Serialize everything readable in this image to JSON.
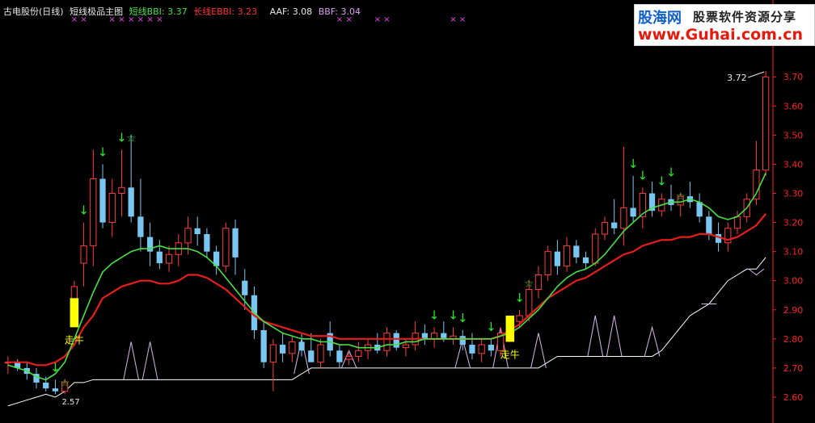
{
  "header": {
    "stock": "古电股份(日线)",
    "indicator": "短线极品主图",
    "short_label": "短线BBI:",
    "short_value": "3.37",
    "long_label": "长线EBBI:",
    "long_value": "3.23",
    "aaf_label": "AAF:",
    "aaf_value": "3.08",
    "bbf_label": "BBF:",
    "bbf_value": "3.04"
  },
  "logo": {
    "name": "股海网",
    "slogan": "股票软件资源分享",
    "url": "www.Guhai.com.cn"
  },
  "colors": {
    "up": "#ff3c3c",
    "down": "#79c7f1",
    "short_line": "#44e044",
    "long_line": "#e81c1c",
    "axis": "#ff2020",
    "signal": "#ffff00",
    "arrow": "#22ee22",
    "lower_line": "#ffffff",
    "spike": "#d9b8ee",
    "mark": "#ee44ee"
  },
  "chart_data": {
    "type": "candlestick",
    "y_axis": {
      "ticks": [
        "2.60",
        "2.70",
        "2.80",
        "2.90",
        "3.00",
        "3.10",
        "3.20",
        "3.30",
        "3.40",
        "3.50",
        "3.60",
        "3.70"
      ],
      "min": 2.55,
      "max": 3.77,
      "side": "right"
    },
    "annotations": {
      "max_label": "3.72",
      "min_label": "2.57",
      "signal_text": "走牛",
      "x_mark": "×",
      "arrow": "↓",
      "star": "☆"
    },
    "candles": [
      [
        2.72,
        2.74,
        2.68,
        2.72
      ],
      [
        2.72,
        2.73,
        2.69,
        2.7
      ],
      [
        2.7,
        2.72,
        2.66,
        2.68
      ],
      [
        2.68,
        2.7,
        2.63,
        2.65
      ],
      [
        2.65,
        2.67,
        2.62,
        2.63
      ],
      [
        2.63,
        2.66,
        2.61,
        2.62
      ],
      [
        2.62,
        2.66,
        2.61,
        2.65
      ],
      [
        2.85,
        3.0,
        2.84,
        2.98
      ],
      [
        3.06,
        3.2,
        2.98,
        3.12
      ],
      [
        3.12,
        3.45,
        3.05,
        3.35
      ],
      [
        3.35,
        3.4,
        3.18,
        3.2
      ],
      [
        3.2,
        3.35,
        3.15,
        3.3
      ],
      [
        3.3,
        3.45,
        3.22,
        3.32
      ],
      [
        3.32,
        3.5,
        3.2,
        3.22
      ],
      [
        3.22,
        3.35,
        3.1,
        3.15
      ],
      [
        3.15,
        3.2,
        3.05,
        3.1
      ],
      [
        3.1,
        3.14,
        3.04,
        3.06
      ],
      [
        3.06,
        3.12,
        3.03,
        3.09
      ],
      [
        3.09,
        3.16,
        3.05,
        3.13
      ],
      [
        3.13,
        3.22,
        3.09,
        3.18
      ],
      [
        3.18,
        3.22,
        3.12,
        3.16
      ],
      [
        3.16,
        3.18,
        3.08,
        3.1
      ],
      [
        3.1,
        3.12,
        3.02,
        3.05
      ],
      [
        3.05,
        3.2,
        3.03,
        3.18
      ],
      [
        3.18,
        3.21,
        3.02,
        3.08
      ],
      [
        3.0,
        3.04,
        2.9,
        2.95
      ],
      [
        2.95,
        2.98,
        2.8,
        2.83
      ],
      [
        2.83,
        2.86,
        2.7,
        2.72
      ],
      [
        2.72,
        2.8,
        2.62,
        2.78
      ],
      [
        2.78,
        2.82,
        2.72,
        2.75
      ],
      [
        2.75,
        2.81,
        2.72,
        2.79
      ],
      [
        2.79,
        2.82,
        2.74,
        2.76
      ],
      [
        2.76,
        2.82,
        2.73,
        2.72
      ],
      [
        2.72,
        2.8,
        2.7,
        2.78
      ],
      [
        2.82,
        2.86,
        2.74,
        2.76
      ],
      [
        2.76,
        2.78,
        2.7,
        2.72
      ],
      [
        2.73,
        2.76,
        2.71,
        2.74
      ],
      [
        2.74,
        2.79,
        2.72,
        2.76
      ],
      [
        2.76,
        2.8,
        2.73,
        2.78
      ],
      [
        2.78,
        2.82,
        2.75,
        2.76
      ],
      [
        2.76,
        2.84,
        2.74,
        2.82
      ],
      [
        2.82,
        2.83,
        2.76,
        2.77
      ],
      [
        2.77,
        2.8,
        2.74,
        2.78
      ],
      [
        2.78,
        2.86,
        2.76,
        2.82
      ],
      [
        2.82,
        2.85,
        2.78,
        2.8
      ],
      [
        2.8,
        2.84,
        2.77,
        2.82
      ],
      [
        2.82,
        2.86,
        2.79,
        2.8
      ],
      [
        2.8,
        2.84,
        2.78,
        2.81
      ],
      [
        2.81,
        2.83,
        2.76,
        2.78
      ],
      [
        2.78,
        2.82,
        2.73,
        2.75
      ],
      [
        2.75,
        2.8,
        2.72,
        2.78
      ],
      [
        2.78,
        2.8,
        2.74,
        2.76
      ],
      [
        2.76,
        2.84,
        2.74,
        2.82
      ],
      [
        2.82,
        2.88,
        2.8,
        2.86
      ],
      [
        2.86,
        2.9,
        2.84,
        2.88
      ],
      [
        2.88,
        3.0,
        2.86,
        2.97
      ],
      [
        2.97,
        3.05,
        2.94,
        3.02
      ],
      [
        3.02,
        3.12,
        3.0,
        3.1
      ],
      [
        3.1,
        3.14,
        3.02,
        3.05
      ],
      [
        3.05,
        3.15,
        3.03,
        3.12
      ],
      [
        3.12,
        3.14,
        3.06,
        3.08
      ],
      [
        3.08,
        3.1,
        3.04,
        3.06
      ],
      [
        3.06,
        3.18,
        3.05,
        3.16
      ],
      [
        3.16,
        3.22,
        3.14,
        3.2
      ],
      [
        3.2,
        3.28,
        3.16,
        3.18
      ],
      [
        3.18,
        3.46,
        3.12,
        3.25
      ],
      [
        3.25,
        3.36,
        3.2,
        3.22
      ],
      [
        3.22,
        3.32,
        3.18,
        3.3
      ],
      [
        3.3,
        3.34,
        3.22,
        3.24
      ],
      [
        3.24,
        3.3,
        3.22,
        3.28
      ],
      [
        3.28,
        3.33,
        3.24,
        3.26
      ],
      [
        3.26,
        3.3,
        3.22,
        3.29
      ],
      [
        3.29,
        3.34,
        3.25,
        3.27
      ],
      [
        3.27,
        3.3,
        3.2,
        3.22
      ],
      [
        3.22,
        3.24,
        3.14,
        3.16
      ],
      [
        3.16,
        3.2,
        3.1,
        3.13
      ],
      [
        3.13,
        3.2,
        3.1,
        3.18
      ],
      [
        3.18,
        3.24,
        3.16,
        3.22
      ],
      [
        3.22,
        3.3,
        3.2,
        3.28
      ],
      [
        3.28,
        3.48,
        3.26,
        3.38
      ],
      [
        3.38,
        3.72,
        3.36,
        3.7
      ]
    ],
    "short_bbi": [
      2.71,
      2.7,
      2.69,
      2.67,
      2.66,
      2.68,
      2.72,
      2.8,
      2.88,
      2.96,
      3.03,
      3.06,
      3.08,
      3.1,
      3.11,
      3.11,
      3.12,
      3.11,
      3.11,
      3.11,
      3.1,
      3.08,
      3.05,
      3.01,
      2.97,
      2.93,
      2.89,
      2.86,
      2.84,
      2.82,
      2.81,
      2.8,
      2.8,
      2.79,
      2.79,
      2.78,
      2.78,
      2.77,
      2.77,
      2.77,
      2.78,
      2.78,
      2.79,
      2.79,
      2.8,
      2.8,
      2.8,
      2.8,
      2.8,
      2.8,
      2.8,
      2.8,
      2.81,
      2.82,
      2.84,
      2.87,
      2.9,
      2.94,
      2.98,
      3.01,
      3.03,
      3.04,
      3.06,
      3.09,
      3.13,
      3.17,
      3.2,
      3.23,
      3.25,
      3.26,
      3.27,
      3.27,
      3.28,
      3.27,
      3.25,
      3.22,
      3.21,
      3.22,
      3.25,
      3.3,
      3.37
    ],
    "long_ebbi": [
      2.72,
      2.72,
      2.72,
      2.71,
      2.71,
      2.72,
      2.74,
      2.78,
      2.84,
      2.88,
      2.94,
      2.96,
      2.98,
      2.99,
      3.0,
      3.0,
      2.99,
      2.99,
      3.0,
      3.02,
      3.02,
      3.01,
      2.99,
      2.97,
      2.94,
      2.91,
      2.88,
      2.86,
      2.85,
      2.84,
      2.83,
      2.82,
      2.81,
      2.81,
      2.81,
      2.8,
      2.8,
      2.8,
      2.8,
      2.8,
      2.8,
      2.8,
      2.8,
      2.8,
      2.8,
      2.8,
      2.8,
      2.8,
      2.8,
      2.8,
      2.8,
      2.8,
      2.81,
      2.83,
      2.85,
      2.88,
      2.91,
      2.94,
      2.96,
      2.98,
      3.0,
      3.01,
      3.03,
      3.05,
      3.07,
      3.09,
      3.1,
      3.12,
      3.13,
      3.14,
      3.14,
      3.15,
      3.15,
      3.16,
      3.16,
      3.15,
      3.14,
      3.15,
      3.17,
      3.19,
      3.23
    ],
    "lower_line": [
      2.57,
      2.58,
      2.59,
      2.6,
      2.61,
      2.6,
      2.62,
      2.65,
      2.65,
      2.66,
      2.66,
      2.66,
      2.66,
      2.66,
      2.66,
      2.66,
      2.66,
      2.66,
      2.66,
      2.66,
      2.66,
      2.66,
      2.66,
      2.66,
      2.66,
      2.66,
      2.66,
      2.66,
      2.66,
      2.66,
      2.66,
      2.68,
      2.7,
      2.7,
      2.7,
      2.7,
      2.7,
      2.7,
      2.7,
      2.7,
      2.7,
      2.7,
      2.7,
      2.7,
      2.7,
      2.7,
      2.7,
      2.7,
      2.7,
      2.7,
      2.7,
      2.7,
      2.7,
      2.7,
      2.7,
      2.7,
      2.7,
      2.72,
      2.74,
      2.74,
      2.74,
      2.74,
      2.74,
      2.74,
      2.74,
      2.74,
      2.74,
      2.74,
      2.74,
      2.76,
      2.8,
      2.84,
      2.88,
      2.9,
      2.92,
      2.96,
      3.0,
      3.02,
      3.04,
      3.04,
      3.08
    ],
    "spikes": [
      [
        13,
        2.79
      ],
      [
        15,
        2.79
      ],
      [
        31,
        2.8
      ],
      [
        36,
        2.76
      ],
      [
        48,
        2.8
      ],
      [
        52,
        2.84
      ],
      [
        56,
        2.82
      ],
      [
        62,
        2.88
      ],
      [
        64,
        2.88
      ],
      [
        68,
        2.84
      ],
      [
        74,
        2.92
      ],
      [
        79,
        3.02
      ]
    ],
    "signals": [
      {
        "i": 7,
        "from": 2.84,
        "to": 2.94
      },
      {
        "i": 53,
        "from": 2.79,
        "to": 2.88
      }
    ],
    "down_arrows": [
      5,
      8,
      10,
      12,
      45,
      47,
      48,
      51,
      54,
      66,
      67,
      69,
      70
    ],
    "stars": [
      6,
      13,
      55,
      71
    ],
    "x_marks": [
      7,
      8,
      11,
      12,
      13,
      14,
      15,
      16,
      35,
      36,
      39,
      40,
      47,
      48,
      78,
      79
    ]
  }
}
